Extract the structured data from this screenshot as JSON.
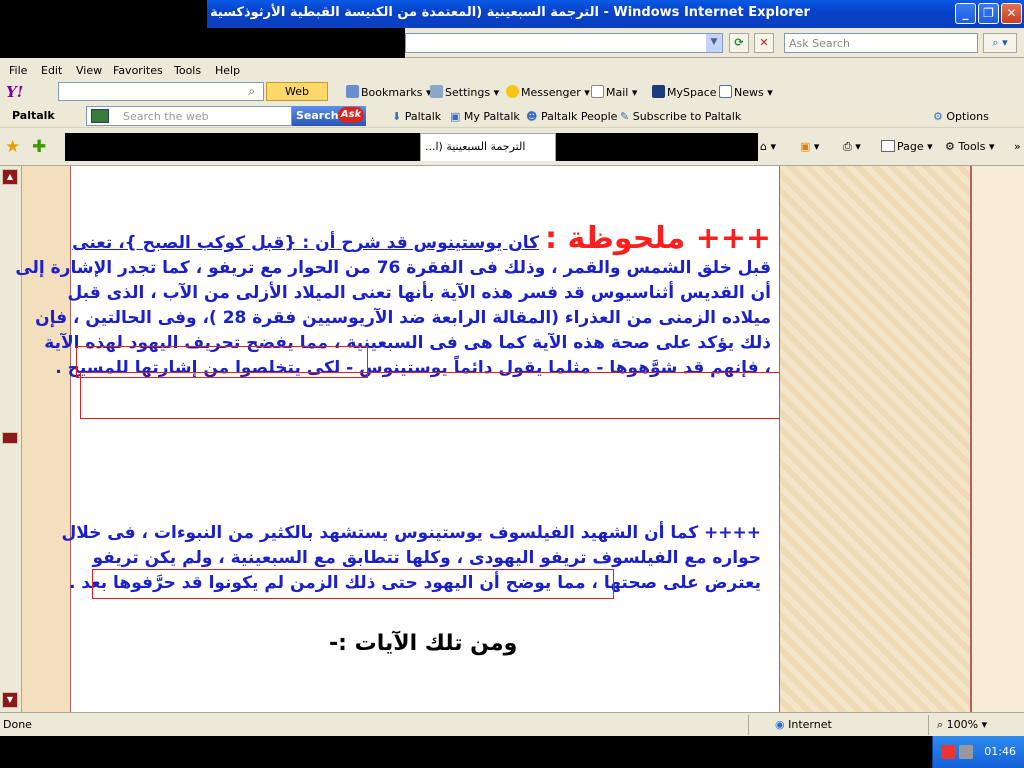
{
  "window": {
    "title": "الترجمة السبعينية (المعتمدة من الكنيسة القبطية الأرثوذكسية - Windows Internet Explorer",
    "buttons": {
      "minimize": "_",
      "maximize": "❐",
      "close": "✕"
    }
  },
  "address_bar": {
    "search_placeholder": "Ask Search"
  },
  "menu": [
    "File",
    "Edit",
    "View",
    "Favorites",
    "Tools",
    "Help"
  ],
  "yahoo_toolbar": {
    "logo": "Y!",
    "search_button": "Web Search",
    "items": [
      "Bookmarks",
      "Settings",
      "Messenger",
      "Mail",
      "MySpace",
      "News"
    ]
  },
  "paltalk_toolbar": {
    "logo": "Paltalk",
    "search_placeholder": "Search the web",
    "search_button": "Search",
    "ask_label": "Ask",
    "links": [
      "Paltalk",
      "My Paltalk",
      "Paltalk People",
      "Subscribe to Paltalk"
    ],
    "options": "Options"
  },
  "tabs": {
    "active_tab": "...الترجمة السبعينية (ا"
  },
  "command_bar": {
    "page": "Page",
    "tools": "Tools"
  },
  "content": {
    "note_title": "+++ ملحوظة :",
    "p1_lines": [
      "كان يوستينوس قد شرح أن : {قبل كوكب الصبح }، تعنى",
      "قبل خلق الشمس والقمر ، وذلك فى الفقرة 76 من الحوار مع تريفو ، كما تجدر الإشارة إلى",
      "أن القديس أثناسيوس قد فسر هذه الآية بأنها تعنى الميلاد الأزلى من الآب ، الذى قبل",
      "ميلاده الزمنى من العذراء (المقالة الرابعة ضد الآريوسيين فقرة 28 )، وفى الحالتين ، فإن",
      "ذلك يؤكد على صحة هذه الآية كما هى فى السبعينية ، مما يفضح تحريف اليهود لهذه الآية",
      "، فإنهم قد شوَّهوها - مثلما يقول دائماً يوستينوس - لكى يتخلصوا من إشارتها للمسيح ."
    ],
    "p2_lines": [
      "++++ كما أن الشهيد الفيلسوف يوستينوس يستشهد بالكثير من النبوءات ، فى خلال",
      "حواره مع الفيلسوف تريفو اليهودى ، وكلها تتطابق مع السبعينية ، ولم يكن تريفو",
      "يعترض على صحتها ، مما يوضح أن اليهود حتى ذلك الزمن لم يكونوا قد حرَّفوها بعد ."
    ],
    "heading": "ومن تلك الآيات :-"
  },
  "status_bar": {
    "status": "Done",
    "zone": "Internet",
    "zoom": "100%"
  },
  "taskbar": {
    "clock": "01:46"
  }
}
